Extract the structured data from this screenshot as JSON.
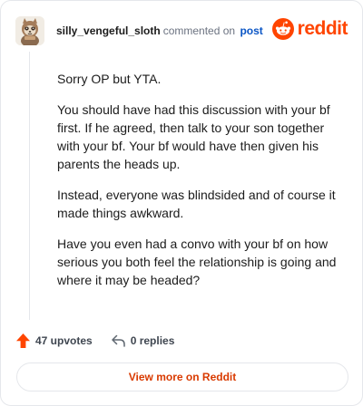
{
  "header": {
    "username": "silly_vengeful_sloth",
    "commented_text": "commented on",
    "post_link": "post",
    "brand": "reddit"
  },
  "comment": {
    "paragraphs": [
      "Sorry OP but YTA.",
      "You should have had this discussion with your bf first. If he agreed, then talk to your son together with your bf. Your bf would have then given his parents the heads up.",
      "Instead, everyone was blindsided and of course it made things awkward.",
      "Have you even had a convo with your bf on how serious you both feel the relationship is going and where it may be headed?"
    ]
  },
  "actions": {
    "upvotes": "47 upvotes",
    "replies": "0 replies"
  },
  "footer": {
    "view_more": "View more on Reddit"
  },
  "colors": {
    "brand": "#ff4500",
    "link": "#0a55c5",
    "button_text": "#d93a00",
    "upvote": "#ff4500"
  },
  "icons": {
    "avatar": "sloth-avatar",
    "brand": "reddit-snoo-icon",
    "upvote": "upvote-arrow-icon",
    "reply": "reply-arrow-icon"
  }
}
